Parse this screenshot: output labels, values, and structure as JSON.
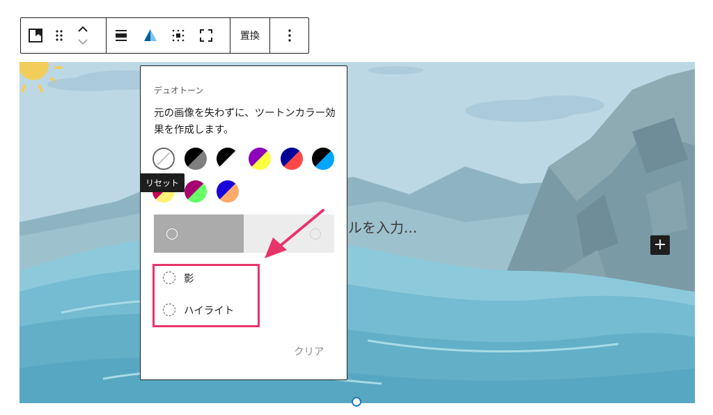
{
  "toolbar": {
    "block_icon": "image-block-icon",
    "drag_icon": "drag-handle-icon",
    "move_icon": "move-up-down-icon",
    "align_icon": "align-icon",
    "duotone_icon": "duotone-filter-icon",
    "focal_icon": "focal-point-icon",
    "fullscreen_icon": "fullscreen-icon",
    "replace_label": "置換",
    "more_icon": "more-options-icon"
  },
  "canvas": {
    "title_placeholder": "ルを入力...",
    "add_block_label": "+"
  },
  "duotone": {
    "title": "デュオトーン",
    "description": "元の画像を失わずに、ツートンカラー効果を作成します。",
    "tooltip": "リセット",
    "swatches": [
      {
        "name": "reset",
        "colors": []
      },
      {
        "name": "dark-grayscale",
        "colors": [
          "#000000",
          "#7f7f7f"
        ]
      },
      {
        "name": "grayscale",
        "colors": [
          "#000000",
          "#ffffff"
        ]
      },
      {
        "name": "purple-yellow",
        "colors": [
          "#8c00b7",
          "#fcff41"
        ]
      },
      {
        "name": "blue-red",
        "colors": [
          "#000097",
          "#ff4747"
        ]
      },
      {
        "name": "midnight",
        "colors": [
          "#000000",
          "#00a5ff"
        ]
      },
      {
        "name": "magenta-yellow",
        "colors": [
          "#c7005a",
          "#fff278"
        ]
      },
      {
        "name": "purple-green",
        "colors": [
          "#a60072",
          "#67ff66"
        ]
      },
      {
        "name": "blue-orange",
        "colors": [
          "#1900d8",
          "#ffa96b"
        ]
      }
    ],
    "shadow_label": "影",
    "highlight_label": "ハイライト",
    "clear_label": "クリア"
  },
  "colors": {
    "accent": "#007cba",
    "annotation": "#e8336b"
  }
}
